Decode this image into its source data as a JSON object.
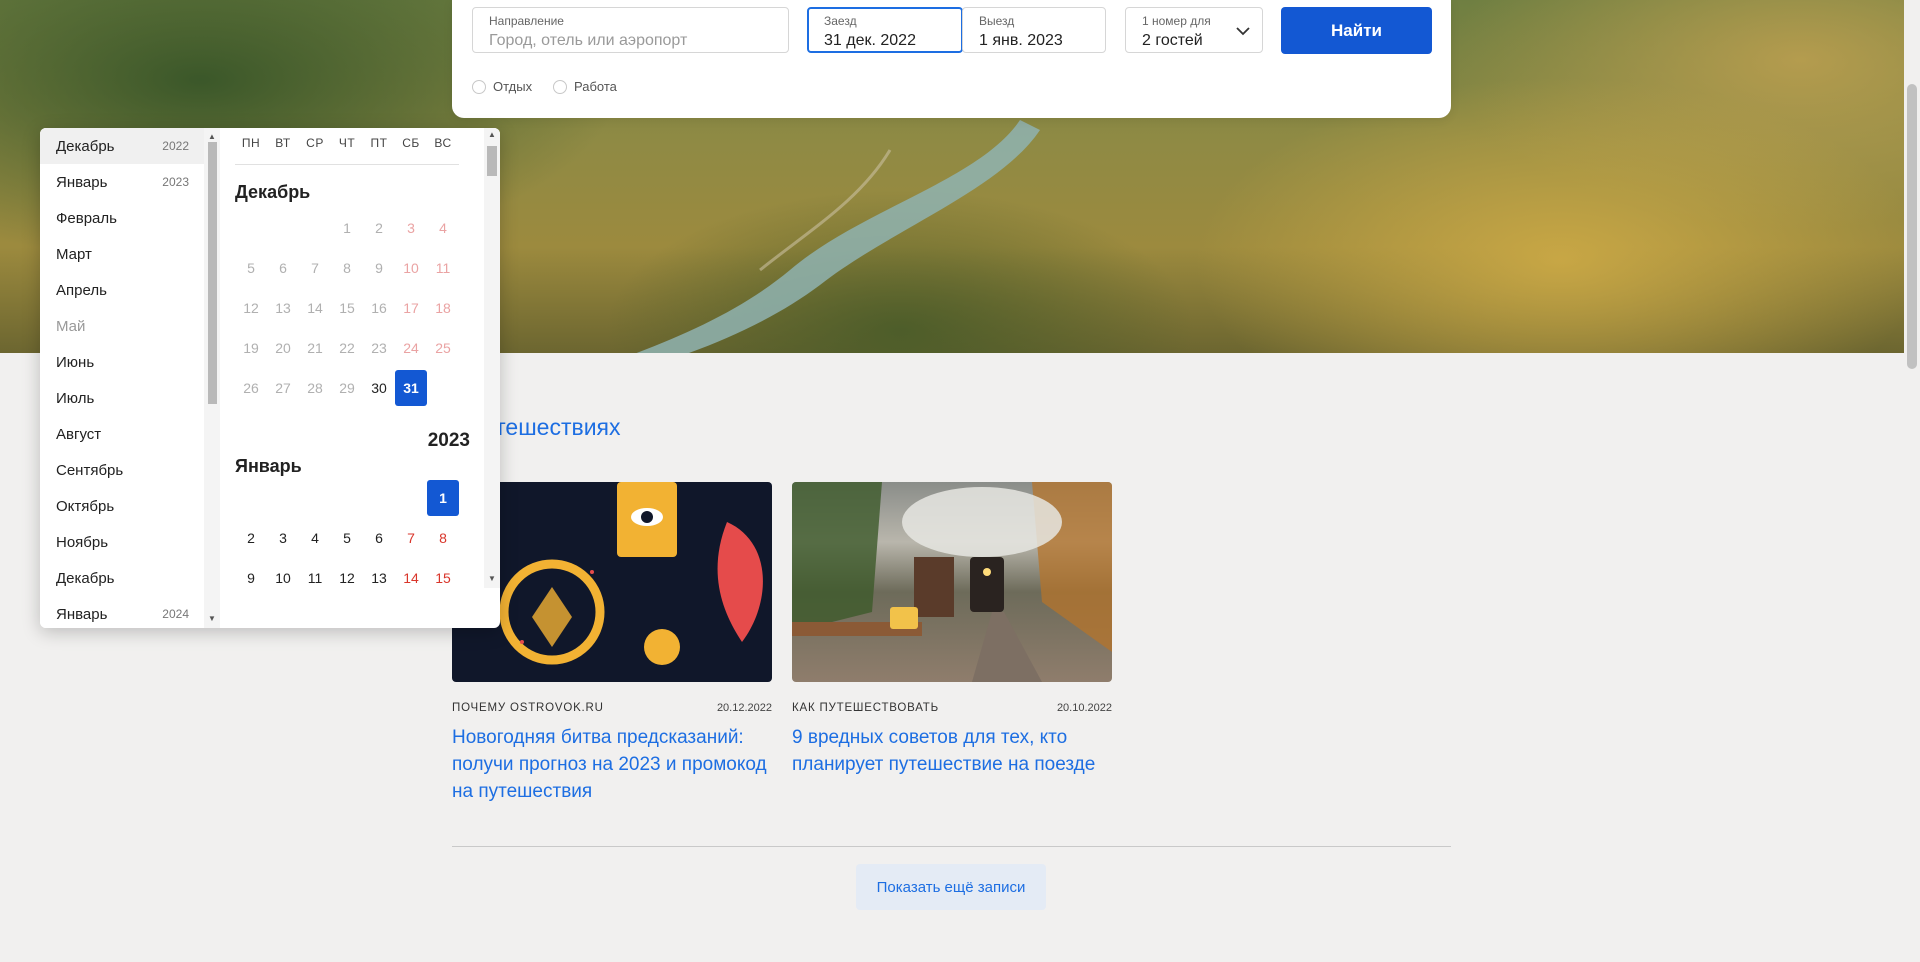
{
  "search": {
    "destination_label": "Направление",
    "destination_placeholder": "Город, отель или аэропорт",
    "checkin_label": "Заезд",
    "checkin_value": "31 дек. 2022",
    "checkout_label": "Выезд",
    "checkout_value": "1 янв. 2023",
    "guests_label": "1 номер для",
    "guests_value": "2 гостей",
    "search_button": "Найти",
    "trip_types": [
      "Отдых",
      "Работа"
    ]
  },
  "calendar": {
    "months_list": [
      {
        "name": "Декабрь",
        "year": "2022"
      },
      {
        "name": "Январь",
        "year": "2023"
      },
      {
        "name": "Февраль",
        "year": ""
      },
      {
        "name": "Март",
        "year": ""
      },
      {
        "name": "Апрель",
        "year": ""
      },
      {
        "name": "Май",
        "year": ""
      },
      {
        "name": "Июнь",
        "year": ""
      },
      {
        "name": "Июль",
        "year": ""
      },
      {
        "name": "Август",
        "year": ""
      },
      {
        "name": "Сентябрь",
        "year": ""
      },
      {
        "name": "Октябрь",
        "year": ""
      },
      {
        "name": "Ноябрь",
        "year": ""
      },
      {
        "name": "Декабрь",
        "year": ""
      },
      {
        "name": "Январь",
        "year": "2024"
      }
    ],
    "weekdays": [
      "ПН",
      "ВТ",
      "СР",
      "ЧТ",
      "ПТ",
      "СБ",
      "ВС"
    ],
    "december": {
      "title": "Декабрь",
      "rows": [
        [
          "",
          "",
          "",
          "1",
          "2",
          "3",
          "4"
        ],
        [
          "5",
          "6",
          "7",
          "8",
          "9",
          "10",
          "11"
        ],
        [
          "12",
          "13",
          "14",
          "15",
          "16",
          "17",
          "18"
        ],
        [
          "19",
          "20",
          "21",
          "22",
          "23",
          "24",
          "25"
        ],
        [
          "26",
          "27",
          "28",
          "29",
          "30",
          "31",
          ""
        ]
      ]
    },
    "year_label": "2023",
    "january": {
      "title": "Январь",
      "rows": [
        [
          "",
          "",
          "",
          "",
          "",
          "",
          "1"
        ],
        [
          "2",
          "3",
          "4",
          "5",
          "6",
          "7",
          "8"
        ],
        [
          "9",
          "10",
          "11",
          "12",
          "13",
          "14",
          "15"
        ]
      ]
    },
    "selected_checkin": "31",
    "selected_checkout": "1"
  },
  "blog": {
    "title": "о путешествиях",
    "cards": [
      {
        "category": "ПОЧЕМУ OSTROVOK.RU",
        "date": "20.12.2022",
        "title": "Новогодняя битва предсказаний: получи прогноз на 2023 и промокод на путешествия"
      },
      {
        "category": "КАК ПУТЕШЕСТВОВАТЬ",
        "date": "20.10.2022",
        "title": "9 вредных советов для тех, кто планирует путешествие на поезде"
      }
    ],
    "more_button": "Показать ещё записи"
  },
  "colors": {
    "accent": "#1358d3",
    "link": "#1d6ee2",
    "weekend": "#d9362b"
  }
}
